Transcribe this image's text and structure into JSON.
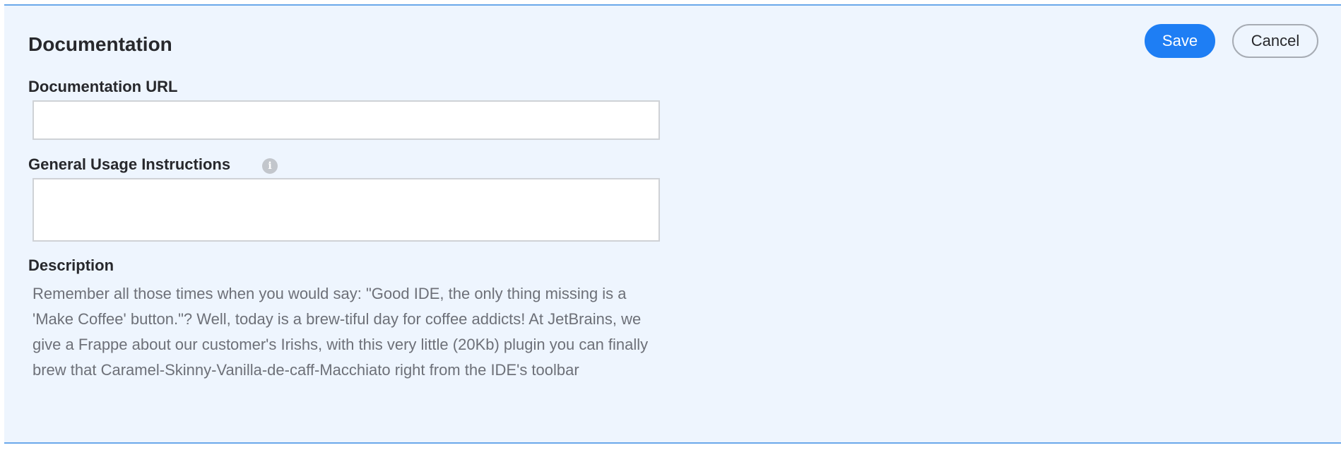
{
  "documentation": {
    "title": "Documentation",
    "save_label": "Save",
    "cancel_label": "Cancel",
    "url_label": "Documentation URL",
    "url_value": "",
    "url_placeholder": "",
    "usage_label": "General Usage Instructions",
    "usage_value": "",
    "usage_placeholder": "",
    "info_icon": "info-icon",
    "info_glyph": "i",
    "description_label": "Description",
    "description_text": "Remember all those times when you would say: \"Good IDE, the only thing missing is a 'Make Coffee' button.\"? Well, today is a brew-tiful day for coffee addicts! At JetBrains, we give a Frappe about our customer's Irishs, with this very little (20Kb) plugin you can finally brew that Caramel-Skinny-Vanilla-de-caff-Macchiato right from the IDE's toolbar"
  },
  "colors": {
    "panel_background": "#eef5fe",
    "panel_border": "#6aa8ea",
    "primary_button": "#1e7ef4",
    "description_text": "#6d7078"
  }
}
